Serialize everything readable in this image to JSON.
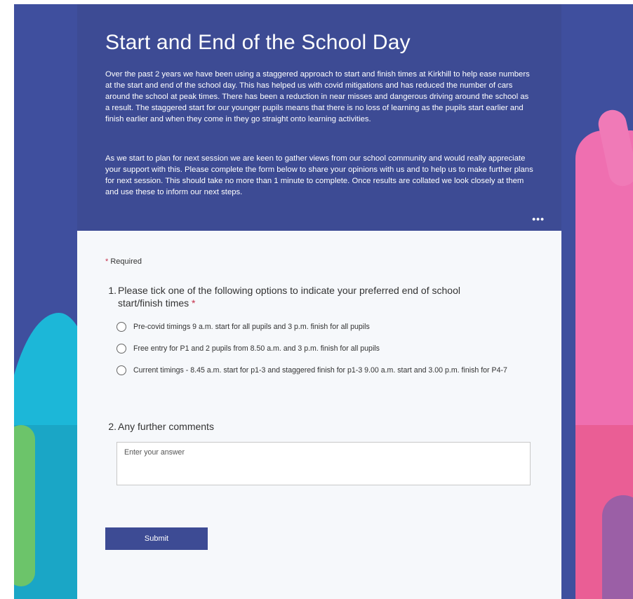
{
  "form": {
    "title": "Start and End of the School Day",
    "intro_p1": "Over the past 2 years we have been using a staggered approach to start and finish times at Kirkhill to help ease numbers at the start and end of the school day. This has helped us with covid mitigations and has reduced the number of cars around the school at peak times. There has been a reduction in near misses and dangerous driving around the school as a result. The staggered start for our younger pupils means that there is no loss of learning as the pupils start earlier and finish earlier and when they come in they go straight onto learning activities.",
    "intro_p2": "As we start to plan for next session we are keen to gather views from our school community and would really appreciate your support with this. Please complete the form below to share your opinions with us and to help us to make further plans for next session. This should take no more than 1 minute to complete. Once results are collated we look closely at them and use these to inform our next steps.",
    "more_menu_icon": "ellipsis-icon",
    "required_star": "*",
    "required_label": "Required",
    "accent_color": "#3d4b94",
    "required_color": "#c4314b"
  },
  "questions": {
    "q1": {
      "number": "1.",
      "text": "Please tick one of the following options to indicate your preferred end of school start/finish times",
      "required_star": "*",
      "options": [
        "Pre-covid timings 9 a.m. start for all pupils and 3 p.m. finish for all pupils",
        "Free entry for P1 and 2 pupils from 8.50 a.m. and 3 p.m. finish for all pupils",
        "Current timings - 8.45 a.m.  start for p1-3 and staggered finish for p1-3 9.00 a.m. start and 3.00 p.m. finish  for P4-7"
      ]
    },
    "q2": {
      "number": "2.",
      "text": "Any further comments",
      "placeholder": "Enter your answer",
      "value": ""
    }
  },
  "submit": {
    "label": "Submit"
  }
}
